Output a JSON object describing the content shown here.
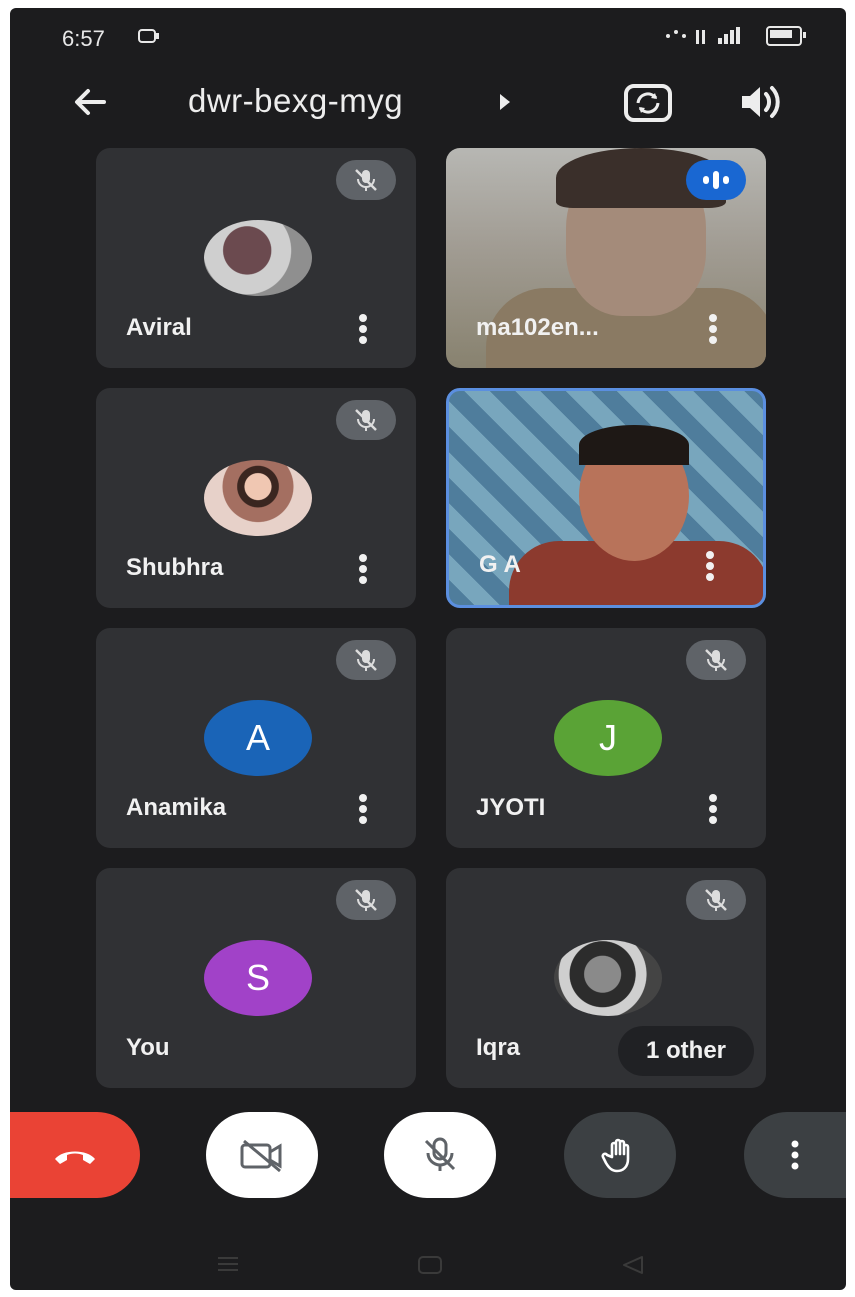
{
  "status_bar": {
    "time": "6:57",
    "indicators": "·°· ░ ᵀᴴıl"
  },
  "header": {
    "meeting_code": "dwr-bexg-myg"
  },
  "tiles": [
    {
      "name": "Aviral",
      "kind": "photo",
      "muted": true
    },
    {
      "name": "ma102en...",
      "kind": "video",
      "speaking": true
    },
    {
      "name": "Shubhra",
      "kind": "photo",
      "muted": true
    },
    {
      "name": "G A",
      "kind": "video",
      "active": true
    },
    {
      "name": "Anamika",
      "kind": "initial",
      "initial": "A",
      "color": "#1a64b7",
      "muted": true
    },
    {
      "name": "JYOTI",
      "kind": "initial",
      "initial": "J",
      "color": "#5aa336",
      "muted": true
    },
    {
      "name": "You",
      "kind": "initial",
      "initial": "S",
      "color": "#a142c8",
      "muted": true
    },
    {
      "name": "Iqra",
      "kind": "photo",
      "muted": true,
      "others_label": "1 other"
    }
  ],
  "controls": {
    "end_call": "phone-hangup-icon",
    "camera": "camera-off-icon",
    "microphone": "mic-off-icon",
    "raise_hand": "hand-icon",
    "more": "more-vert-icon"
  },
  "colors": {
    "end_call": "#ea4335",
    "speaking": "#1967d2",
    "tile": "#303134",
    "active_border": "#5b8fe0"
  }
}
